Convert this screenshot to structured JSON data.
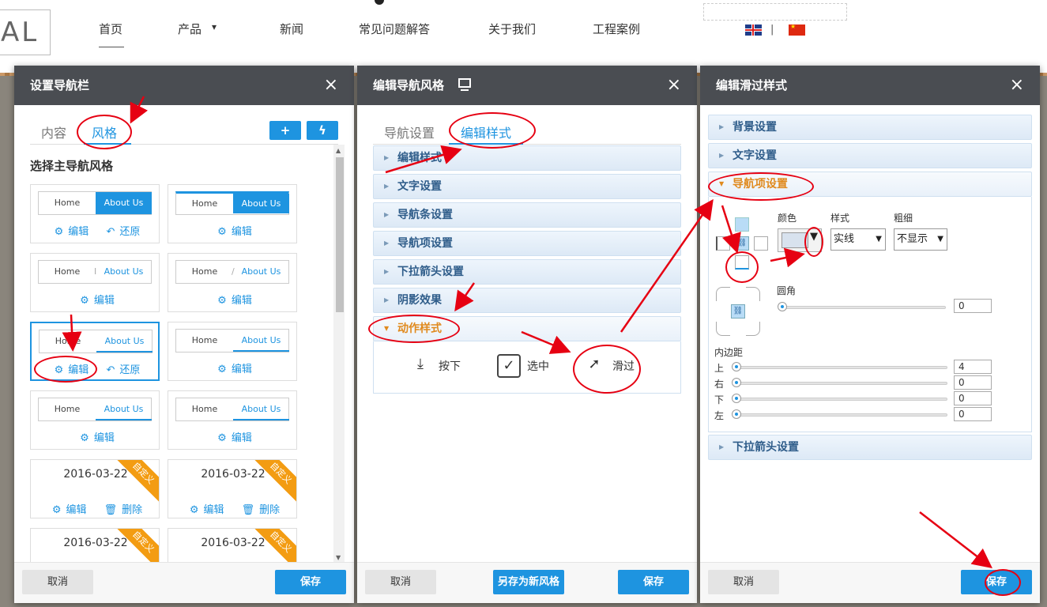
{
  "site": {
    "logo": "AL",
    "nav": [
      "首页",
      "产品",
      "新闻",
      "常见问题解答",
      "关于我们",
      "工程案例"
    ],
    "product_caret": "▾",
    "lang_sep": "|"
  },
  "dialog1": {
    "title": "设置导航栏",
    "close": "×",
    "tabs": [
      "内容",
      "风格"
    ],
    "add_icon": "+",
    "flash_icon": "ϟ",
    "section_title": "选择主导航风格",
    "preview_home": "Home",
    "preview_about": "About Us",
    "edit_label": "编辑",
    "restore_label": "还原",
    "delete_label": "删除",
    "custom_date": "2016-03-22",
    "custom_ribbon": "自定义",
    "sep_bar": "I",
    "sep_slash": "/",
    "cancel": "取消",
    "save": "保存"
  },
  "dialog2": {
    "title": "编辑导航风格",
    "close": "×",
    "tabs": [
      "导航设置",
      "编辑样式"
    ],
    "accordion": [
      "编辑样式",
      "文字设置",
      "导航条设置",
      "导航项设置",
      "下拉箭头设置",
      "阴影效果",
      "动作样式"
    ],
    "actions": [
      "按下",
      "选中",
      "滑过"
    ],
    "cancel": "取消",
    "save_new": "另存为新风格",
    "save": "保存"
  },
  "dialog3": {
    "title": "编辑滑过样式",
    "close": "×",
    "accordion": [
      "背景设置",
      "文字设置",
      "导航项设置",
      "下拉箭头设置"
    ],
    "color_label": "颜色",
    "style_label": "样式",
    "weight_label": "粗细",
    "style_value": "实线",
    "weight_value": "不显示",
    "radius_label": "圆角",
    "radius_value": "0",
    "padding_label": "内边距",
    "padding": [
      {
        "side": "上",
        "value": "4"
      },
      {
        "side": "右",
        "value": "0"
      },
      {
        "side": "下",
        "value": "0"
      },
      {
        "side": "左",
        "value": "0"
      }
    ],
    "cancel": "取消",
    "save": "保存"
  },
  "colors": {
    "accent": "#1e94e0",
    "header": "#4a4d52",
    "annotation": "#e60012",
    "open_section": "#e08a1e",
    "ribbon": "#f39c12"
  }
}
